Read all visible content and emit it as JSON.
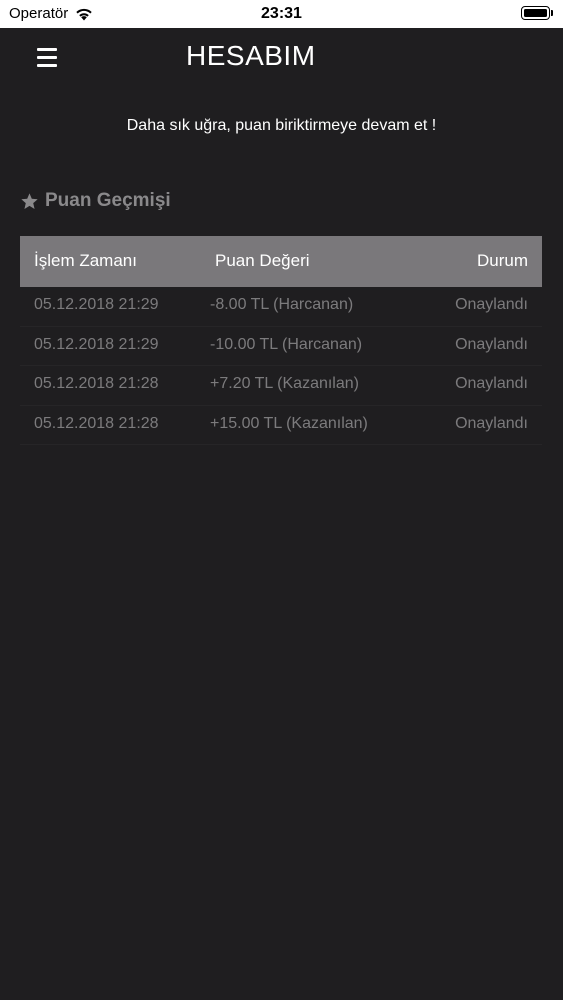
{
  "status_bar": {
    "carrier": "Operatör",
    "time": "23:31"
  },
  "nav": {
    "title": "HESABIM"
  },
  "motto": "Daha sık uğra, puan biriktirmeye devam et !",
  "section": {
    "title": "Puan Geçmişi"
  },
  "table": {
    "headers": [
      "İşlem Zamanı",
      "Puan Değeri",
      "Durum"
    ],
    "rows": [
      {
        "time": "05.12.2018 21:29",
        "value": "-8.00 TL (Harcanan)",
        "status": "Onaylandı"
      },
      {
        "time": "05.12.2018 21:29",
        "value": "-10.00 TL (Harcanan)",
        "status": "Onaylandı"
      },
      {
        "time": "05.12.2018 21:28",
        "value": "+7.20 TL (Kazanılan)",
        "status": "Onaylandı"
      },
      {
        "time": "05.12.2018 21:28",
        "value": "+15.00 TL (Kazanılan)",
        "status": "Onaylandı"
      }
    ]
  },
  "colors": {
    "background": "#1f1e20",
    "table_header": "#7a787b",
    "muted_text": "#7c7b7d",
    "section_title": "#8a898b"
  },
  "battery_level": 1.0
}
